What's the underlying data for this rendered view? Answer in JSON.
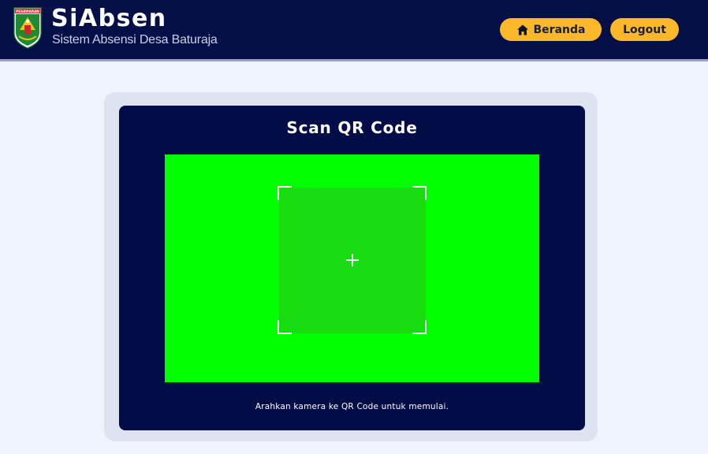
{
  "header": {
    "logo_text": "PESAWARAN",
    "title": "SiAbsen",
    "subtitle": "Sistem Absensi Desa Baturaja",
    "nav": {
      "home_label": "Beranda",
      "home_icon": "home-icon",
      "logout_label": "Logout"
    }
  },
  "scanner": {
    "title": "Scan QR Code",
    "hint": "Arahkan kamera ke QR Code untuk memulai."
  },
  "colors": {
    "navbar": "#040f47",
    "accent": "#fdb72a",
    "camera": "#00ff00",
    "card": "#020c47"
  }
}
